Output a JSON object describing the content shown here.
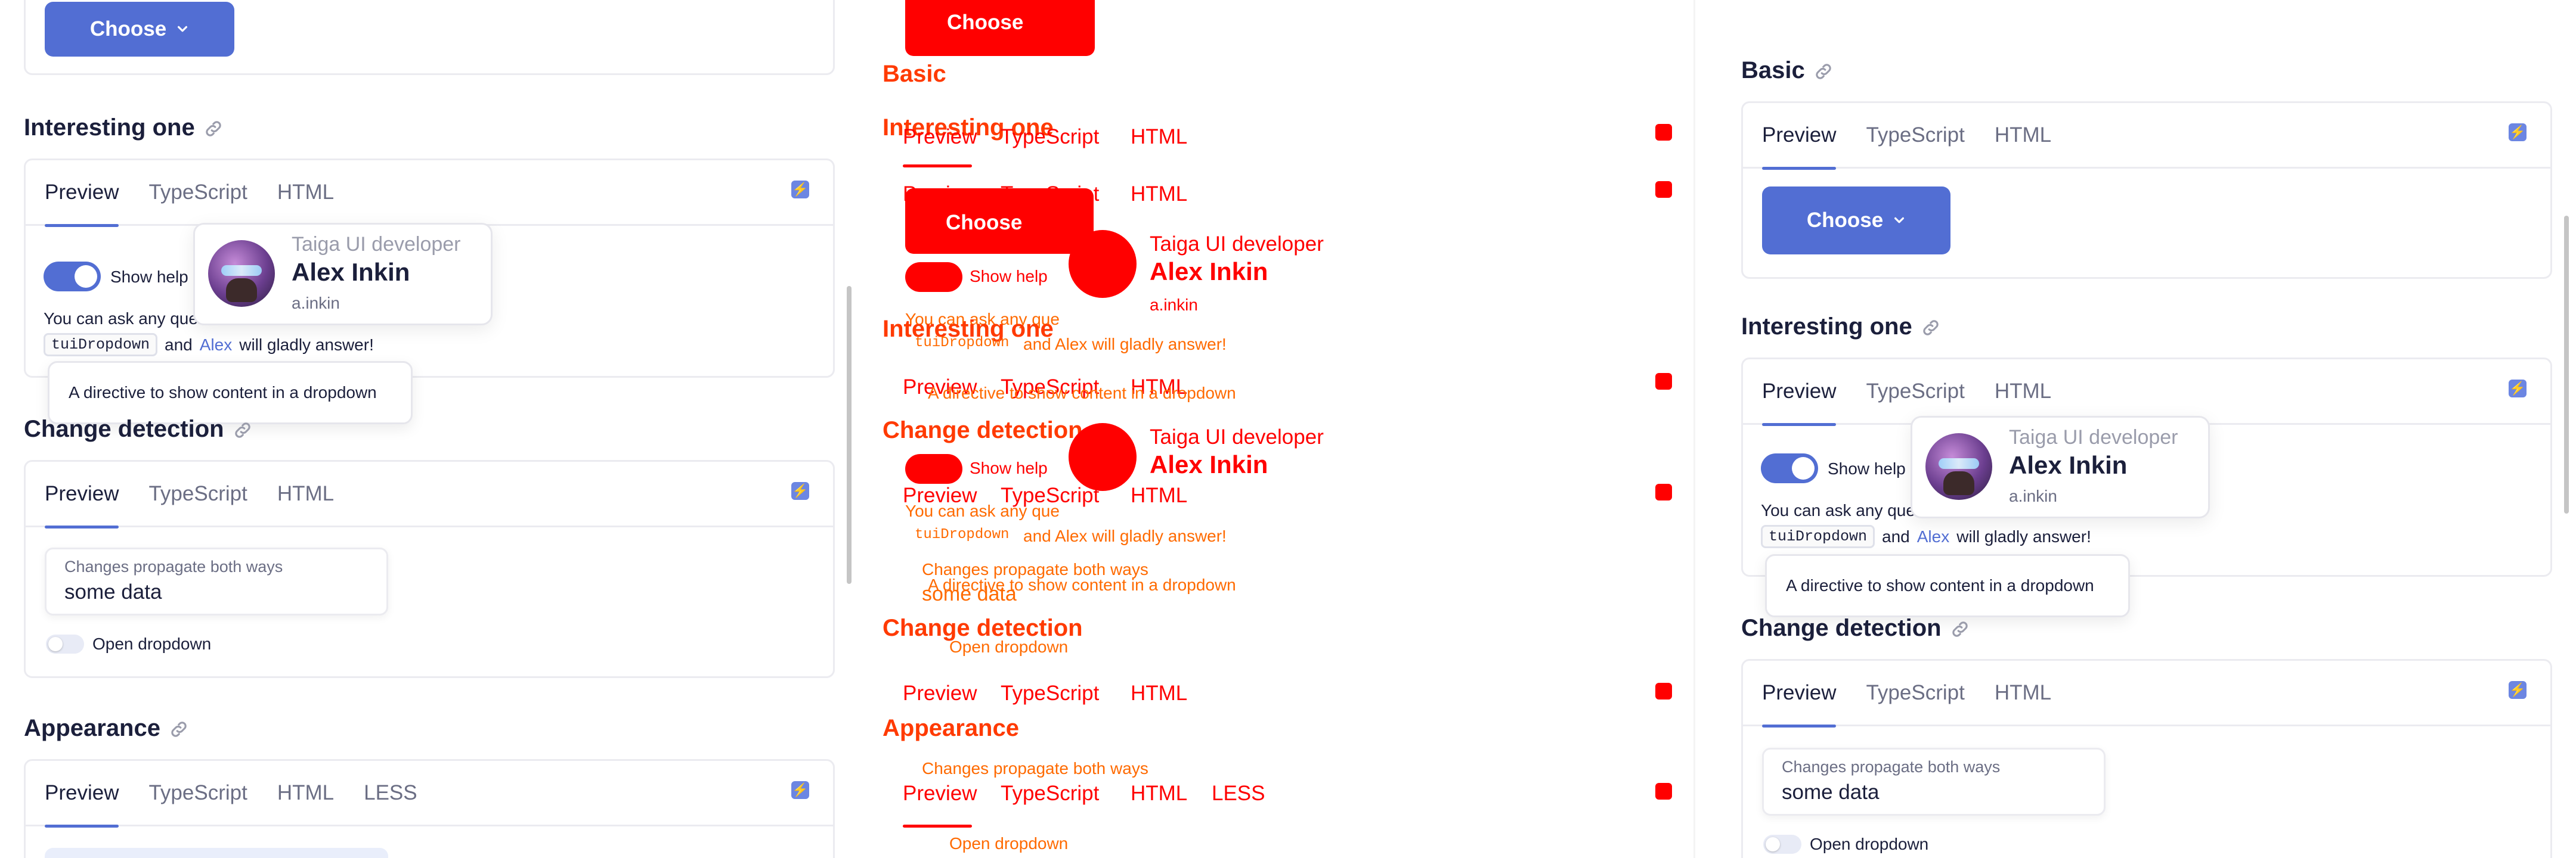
{
  "sections": {
    "basic": "Basic",
    "interesting": "Interesting one",
    "change_detection": "Change detection",
    "appearance": "Appearance"
  },
  "tabs": {
    "preview": "Preview",
    "typescript": "TypeScript",
    "html": "HTML",
    "less": "LESS"
  },
  "choose_button": "Choose",
  "show_help": "Show help",
  "ask_prefix": "You can ask any ques",
  "ask_code": "tuiDropdown",
  "ask_and": "and",
  "ask_link": "Alex",
  "ask_suffix": "will gladly answer!",
  "popover": {
    "role": "Taiga UI developer",
    "name": "Alex Inkin",
    "handle": "a.inkin"
  },
  "tooltip": "A directive to show content in a dropdown",
  "input": {
    "label": "Changes propagate both ways",
    "value": "some data"
  },
  "open_dropdown": "Open dropdown",
  "diff_inline": {
    "ask_short": "You can ask any que",
    "ask_end": "and Alex will gladly answer!"
  },
  "colors": {
    "accent": "#526ed3",
    "diff_red": "#ff0000",
    "diff_orange": "#ff6a00"
  }
}
